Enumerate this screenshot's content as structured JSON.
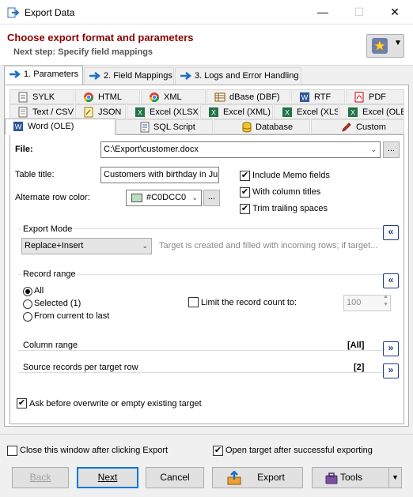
{
  "window": {
    "title": "Export Data",
    "minimize": "—",
    "maximize": "☐",
    "close": "✕"
  },
  "header": {
    "title": "Choose export format and parameters",
    "subtitle": "Next step: Specify field mappings"
  },
  "steps": [
    {
      "label": "1. Parameters"
    },
    {
      "label": "2. Field Mappings"
    },
    {
      "label": "3. Logs and Error Handling"
    }
  ],
  "formats": {
    "row1": [
      "SYLK",
      "HTML",
      "XML",
      "dBase (DBF)",
      "RTF",
      "PDF"
    ],
    "row2": [
      "Text / CSV",
      "JSON",
      "Excel (XLSX)",
      "Excel (XML)",
      "Excel (XLS)",
      "Excel (OLE)"
    ],
    "row3": [
      "Word (OLE)",
      "SQL Script",
      "Database",
      "Custom"
    ]
  },
  "form": {
    "file_label": "File:",
    "file_value": "C:\\Export\\customer.docx",
    "browse": "...",
    "table_title_label": "Table title:",
    "table_title_value": "Customers with birthday in Jul",
    "alt_color_label": "Alternate row color:",
    "alt_color_value": "#C0DCC0",
    "alt_color_hex": "#C0DCC0",
    "include_memo": "Include Memo fields",
    "with_titles": "With column titles",
    "trim_spaces": "Trim trailing spaces"
  },
  "export_mode": {
    "title": "Export Mode",
    "selected": "Replace+Insert",
    "description": "Target is created and filled with incoming rows; if target..."
  },
  "record_range": {
    "title": "Record range",
    "all": "All",
    "selected": "Selected (1)",
    "from_current": "From current to last",
    "limit_label": "Limit the record count to:",
    "limit_value": "100"
  },
  "column_range": {
    "title": "Column range",
    "value": "[All]"
  },
  "source_records": {
    "title": "Source records per target row",
    "value": "[2]"
  },
  "ask_overwrite": "Ask before overwrite or empty existing target",
  "footer": {
    "close_after": "Close this window after clicking Export",
    "open_target": "Open target after successful exporting"
  },
  "buttons": {
    "back": "Back",
    "next": "Next",
    "cancel": "Cancel",
    "export": "Export",
    "tools": "Tools"
  },
  "colors": {
    "header_title": "#8b0000",
    "accent": "#1f3c88",
    "selection_blue": "#0078d7"
  }
}
